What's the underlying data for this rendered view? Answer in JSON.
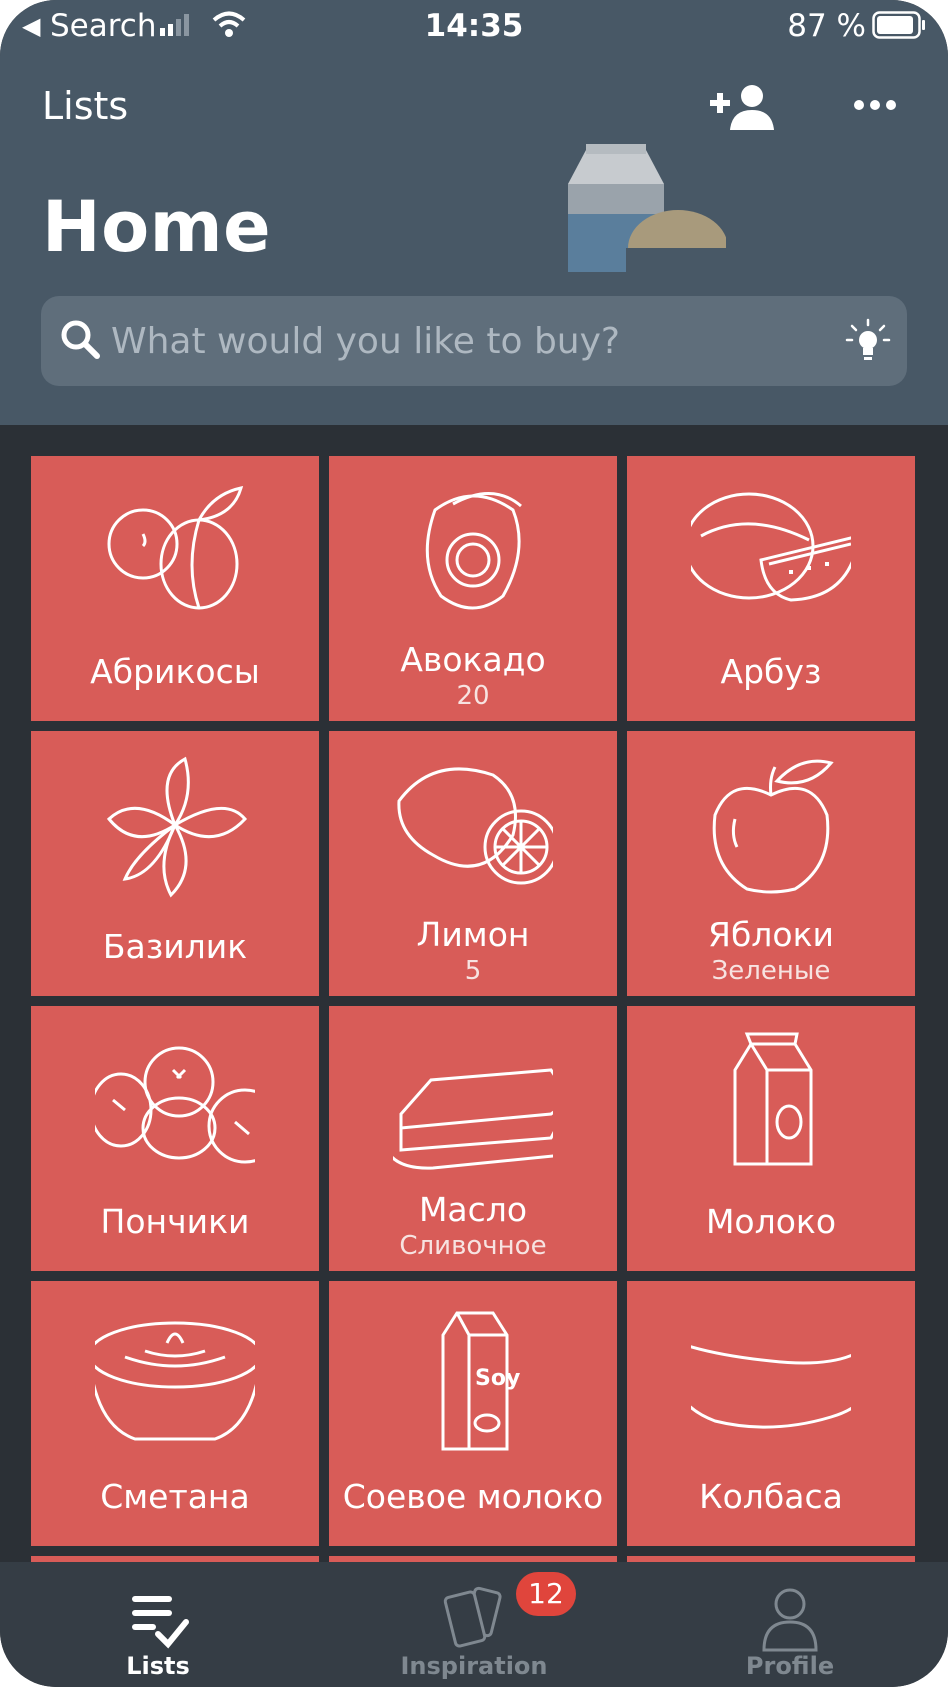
{
  "status_bar": {
    "back_label": "Search",
    "time": "14:35",
    "battery_percent": "87 %"
  },
  "header": {
    "nav_title": "Lists",
    "page_title": "Home",
    "search_placeholder": "What would you like to buy?"
  },
  "items": [
    {
      "name": "Абрикосы",
      "note": "",
      "icon": "apricot-icon"
    },
    {
      "name": "Авокадо",
      "note": "20",
      "icon": "avocado-icon"
    },
    {
      "name": "Арбуз",
      "note": "",
      "icon": "watermelon-icon"
    },
    {
      "name": "Базилик",
      "note": "",
      "icon": "basil-icon"
    },
    {
      "name": "Лимон",
      "note": "5",
      "icon": "lemon-icon"
    },
    {
      "name": "Яблоки",
      "note": "Зеленые",
      "icon": "apple-icon"
    },
    {
      "name": "Пончики",
      "note": "",
      "icon": "donuts-icon"
    },
    {
      "name": "Масло",
      "note": "Сливочное",
      "icon": "butter-icon"
    },
    {
      "name": "Молоко",
      "note": "",
      "icon": "milk-carton-icon"
    },
    {
      "name": "Сметана",
      "note": "",
      "icon": "sour-cream-icon"
    },
    {
      "name": "Соевое молоко",
      "note": "",
      "icon": "soy-milk-icon"
    },
    {
      "name": "Колбаса",
      "note": "",
      "icon": "sausage-icon"
    }
  ],
  "tab_bar": {
    "tabs": [
      {
        "label": "Lists",
        "icon": "list-check-icon",
        "active": true
      },
      {
        "label": "Inspiration",
        "icon": "cards-icon",
        "active": false
      },
      {
        "label": "Profile",
        "icon": "person-icon",
        "active": false
      }
    ],
    "inspiration_badge": "12"
  },
  "colors": {
    "header": "#485866",
    "background": "#2b3036",
    "tile": "#d85c58",
    "tab_bar": "#353d45",
    "badge": "#e0453c"
  }
}
